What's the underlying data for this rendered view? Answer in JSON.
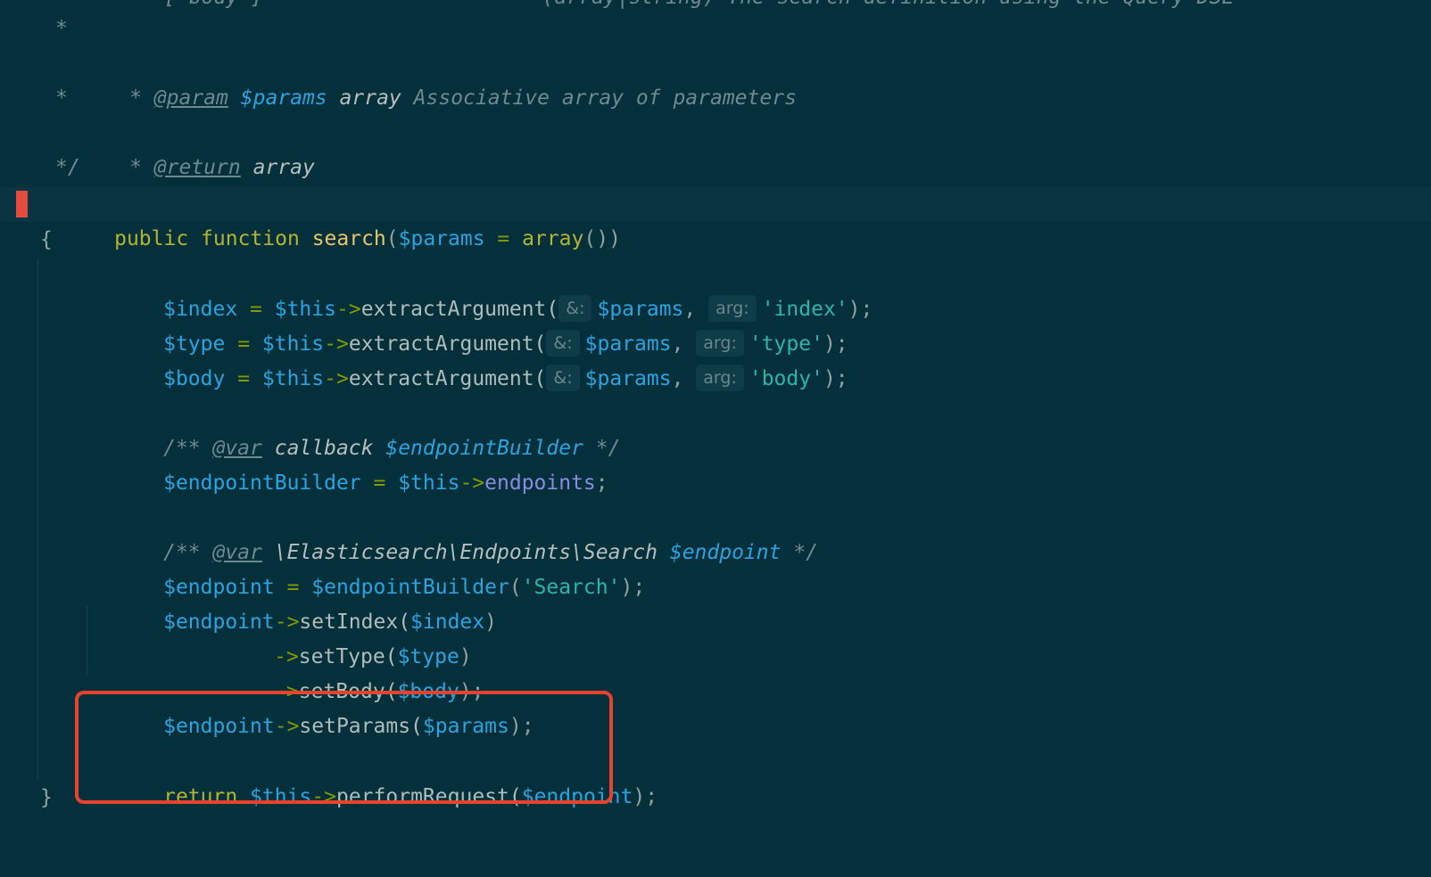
{
  "editor": {
    "language": "PHP",
    "theme_background": "#04303b",
    "lines": {
      "l0": {
        "star": "[ body ]",
        "mid": "= (array|string) The search definition using the Query DSL"
      },
      "l1": {
        "star": "*"
      },
      "l2": {
        "star": "* ",
        "tag": "@param",
        "var": "$params",
        "type": "array",
        "desc": "Associative array of parameters"
      },
      "l3": {
        "star": "*"
      },
      "l4": {
        "star": "* ",
        "tag": "@return",
        "type": "array"
      },
      "l5": {
        "star": "*/"
      },
      "l6": {
        "kw1": "public",
        "kw2": "function",
        "name": "search",
        "open": "(",
        "var": "$params",
        "eq": " = ",
        "call": "array",
        "close": "())"
      },
      "l7": {
        "text": "{"
      },
      "l8": {
        "var": "$index",
        "eq": " = ",
        "this": "$this",
        "arrow": "->",
        "method": "extractArgument(",
        "hint1": "&:",
        "arg1": "$params",
        "comma": ", ",
        "hint2": "arg:",
        "arg2": "'index'",
        "end": ");"
      },
      "l9": {
        "var": "$type",
        "eq": " = ",
        "this": "$this",
        "arrow": "->",
        "method": "extractArgument(",
        "hint1": "&:",
        "arg1": "$params",
        "comma": ", ",
        "hint2": "arg:",
        "arg2": "'type'",
        "end": ");"
      },
      "l10": {
        "var": "$body",
        "eq": " = ",
        "this": "$this",
        "arrow": "->",
        "method": "extractArgument(",
        "hint1": "&:",
        "arg1": "$params",
        "comma": ", ",
        "hint2": "arg:",
        "arg2": "'body'",
        "end": ");"
      },
      "l12": {
        "open": "/** ",
        "tag": "@var",
        "type": " callback ",
        "var": "$endpointBuilder",
        "close": " */"
      },
      "l13": {
        "var": "$endpointBuilder",
        "eq": " = ",
        "this": "$this",
        "arrow": "->",
        "prop": "endpoints",
        "end": ";"
      },
      "l15": {
        "open": "/** ",
        "tag": "@var",
        "type": " \\Elasticsearch\\Endpoints\\Search ",
        "var": "$endpoint",
        "close": " */"
      },
      "l16": {
        "var": "$endpoint",
        "eq": " = ",
        "call": "$endpointBuilder",
        "open": "(",
        "str": "'Search'",
        "end": ");"
      },
      "l17": {
        "var": "$endpoint",
        "arrow": "->",
        "method": "setIndex(",
        "arg": "$index",
        "end": ")"
      },
      "l18": {
        "arrow": "->",
        "method": "setType(",
        "arg": "$type",
        "end": ")"
      },
      "l19": {
        "arrow": "->",
        "method": "setBody(",
        "arg": "$body",
        "end": ");"
      },
      "l20": {
        "var": "$endpoint",
        "arrow": "->",
        "method": "setParams(",
        "arg": "$params",
        "end": ");"
      },
      "l22": {
        "kw": "return",
        "this": "$this",
        "arrow": "->",
        "method": "performRequest(",
        "arg": "$endpoint",
        "end": ");"
      },
      "l23": {
        "text": "}"
      }
    }
  }
}
